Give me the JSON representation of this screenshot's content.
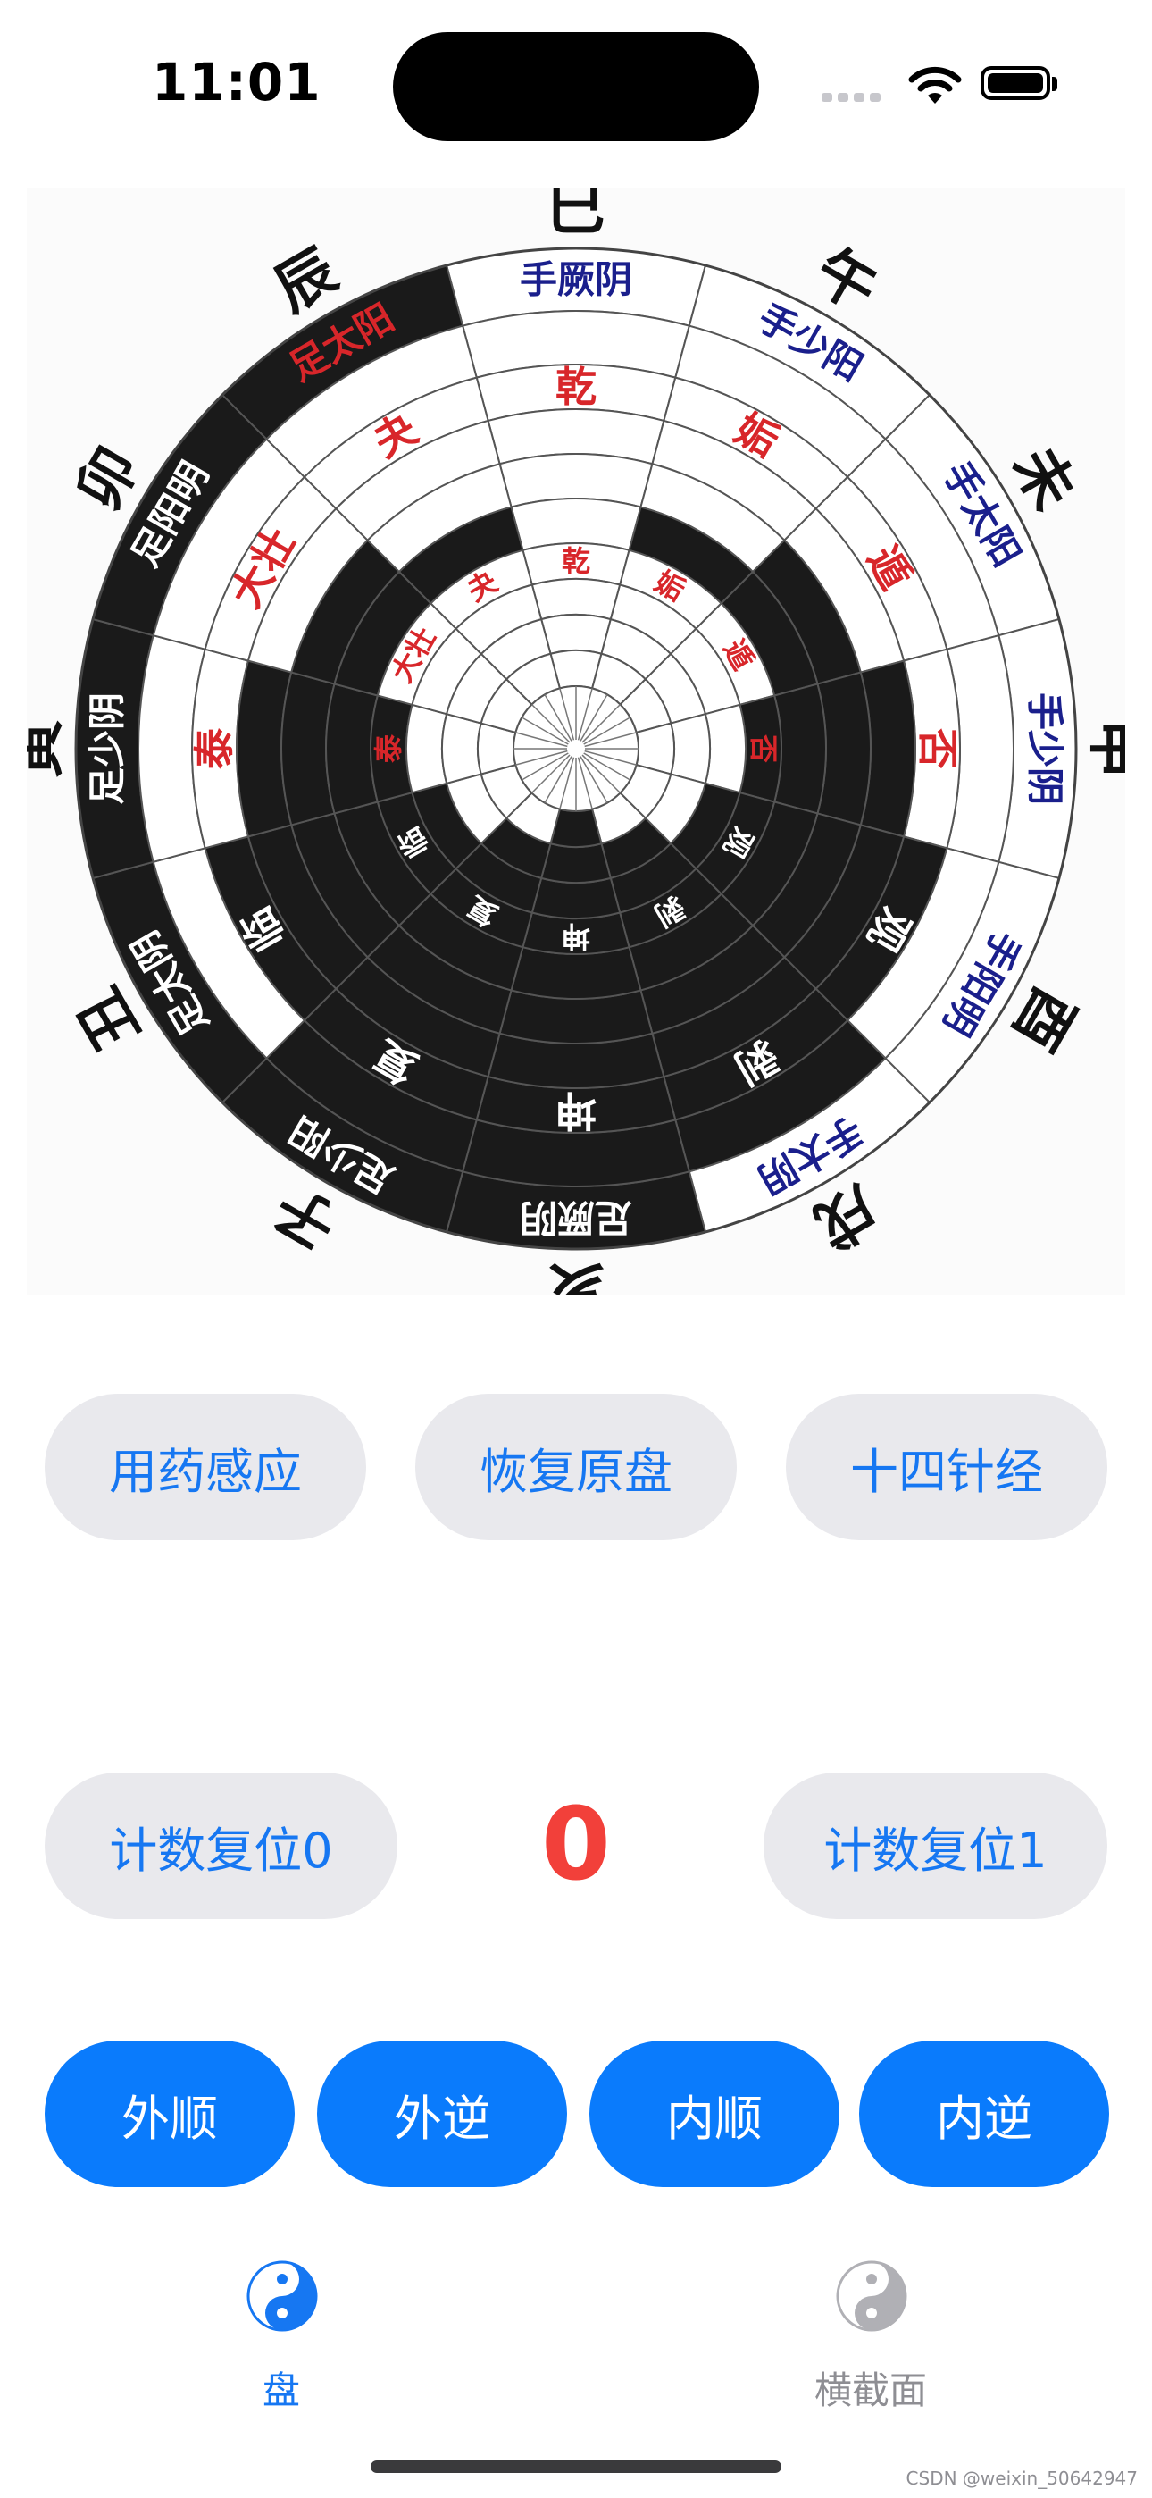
{
  "status_bar": {
    "time": "11:01"
  },
  "wheel": {
    "branches": [
      "巳",
      "午",
      "未",
      "申",
      "酉",
      "戌",
      "亥",
      "子",
      "丑",
      "寅",
      "卯",
      "辰"
    ],
    "meridians_outer": [
      "手厥阴",
      "手少阳",
      "手太阳",
      "手少阴",
      "手阳明",
      "手太阴",
      "足厥阴",
      "足少阳",
      "足太阴",
      "足少阴",
      "足阳明",
      "足太阳"
    ],
    "hexagrams_middle": [
      "乾",
      "姤",
      "遁",
      "否",
      "观",
      "剥",
      "坤",
      "复",
      "临",
      "泰",
      "大壮",
      "夬"
    ],
    "hexagrams_inner": [
      "乾",
      "姤",
      "遁",
      "否",
      "观",
      "剥",
      "坤",
      "复",
      "临",
      "泰",
      "大壮",
      "夬"
    ],
    "colors": {
      "red": "#d8262a",
      "navy": "#1a1f8c",
      "black": "#1a1a1a"
    }
  },
  "controls": {
    "row1": [
      "用药感应",
      "恢复原盘",
      "十四针经"
    ],
    "reset0": "计数复位0",
    "count": "0",
    "reset1": "计数复位1",
    "row3": [
      "外顺",
      "外逆",
      "内顺",
      "内逆"
    ]
  },
  "tabbar": {
    "tabs": [
      {
        "label": "盘",
        "icon": "yin-yang-icon",
        "active": true
      },
      {
        "label": "横截面",
        "icon": "yin-yang-icon",
        "active": false
      }
    ]
  },
  "watermark": "CSDN @weixin_50642947"
}
